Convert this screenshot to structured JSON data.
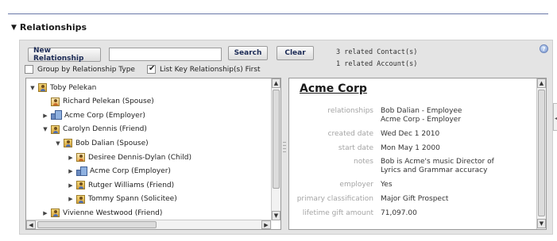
{
  "section": {
    "title": "Relationships",
    "toggle_icon": "triangle-down-icon"
  },
  "toolbar": {
    "new_relationship_label": "New Relationship",
    "search_value": "",
    "search_label": "Search",
    "clear_label": "Clear",
    "related_contacts": "3 related Contact(s)",
    "related_accounts": "1 related Account(s)",
    "help_icon": "help-icon",
    "group_by_type_label": "Group by Relationship Type",
    "group_by_type_checked": false,
    "list_key_first_label": "List Key Relationship(s) First",
    "list_key_first_checked": true
  },
  "tree": {
    "rows": [
      {
        "label": "Toby Pelekan",
        "toggle": "▼",
        "icon": "contact-icon",
        "depth": 0
      },
      {
        "label": "Richard Pelekan (Spouse)",
        "toggle": "",
        "icon": "contact-icon",
        "depth": 1
      },
      {
        "label": "Acme Corp (Employer)",
        "toggle": "▶",
        "icon": "account-icon",
        "depth": 1
      },
      {
        "label": "Carolyn Dennis (Friend)",
        "toggle": "▼",
        "icon": "contact-icon",
        "depth": 1
      },
      {
        "label": "Bob Dalian (Spouse)",
        "toggle": "▼",
        "icon": "contact-icon",
        "depth": 2
      },
      {
        "label": "Desiree Dennis-Dylan (Child)",
        "toggle": "▶",
        "icon": "contact-icon",
        "depth": 3
      },
      {
        "label": "Acme Corp (Employer)",
        "toggle": "▶",
        "icon": "account-icon",
        "depth": 3
      },
      {
        "label": "Rutger Williams (Friend)",
        "toggle": "▶",
        "icon": "contact-icon",
        "depth": 3
      },
      {
        "label": "Tommy Spann (Solicitee)",
        "toggle": "▶",
        "icon": "contact-icon",
        "depth": 3
      },
      {
        "label": "Vivienne Westwood (Friend)",
        "toggle": "▶",
        "icon": "contact-icon",
        "depth": 1
      }
    ]
  },
  "detail": {
    "title": "Acme Corp",
    "fields": {
      "relationships_label": "relationships",
      "relationships_1": "Bob Dalian - Employee",
      "relationships_2": "Acme Corp - Employer",
      "created_label": "created date",
      "created_value": "Wed Dec 1 2010",
      "start_label": "start date",
      "start_value": "Mon May 1 2000",
      "notes_label": "notes",
      "notes_1": "Bob is Acme's music Director of",
      "notes_2": "Lyrics and Grammar accuracy",
      "employer_label": "employer",
      "employer_value": "Yes",
      "primary_label": "primary classification",
      "primary_value": "Major Gift Prospect",
      "lifetime_label": "lifetime gift amount",
      "lifetime_value": "71,097.00"
    }
  },
  "colors": {
    "accent_rule": "#6a78a8",
    "button_text": "#1b2a55",
    "label_gray": "#a4a4a4"
  }
}
